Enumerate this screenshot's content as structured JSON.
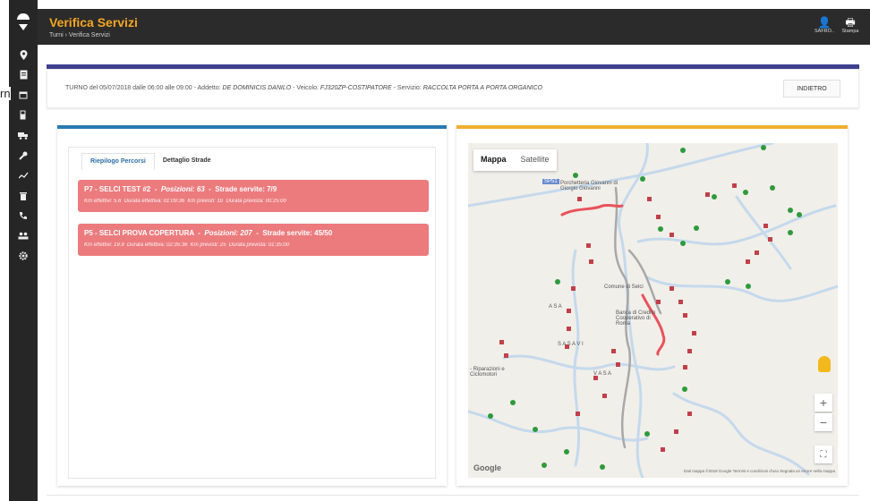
{
  "stray_text": "rn",
  "header": {
    "title": "Verifica Servizi",
    "breadcrumb": "Turni › Verifica Servizi",
    "actions": [
      {
        "label": "SAFRO..",
        "icon": "user-icon"
      },
      {
        "label": "Stampa",
        "icon": "print-icon"
      }
    ]
  },
  "sidebar": {
    "icons": [
      "map-pin-icon",
      "document-icon",
      "calendar-icon",
      "fuel-icon",
      "truck-icon",
      "wrench-icon",
      "chart-icon",
      "trash-icon",
      "phone-icon",
      "users-icon",
      "gear-icon"
    ]
  },
  "shift": {
    "date_label": "TURNO del 05/07/2018 dalle 06:00 alle 09:00",
    "addetto_label": "Addetto:",
    "addetto": "DE DOMINICIS DANILO",
    "veicolo_label": "Veicolo:",
    "veicolo": "FJ320ZP-COSTIPATORE",
    "servizio_label": "Servizio:",
    "servizio": "RACCOLTA PORTA A PORTA ORGANICO",
    "sep": "-",
    "back_label": "INDIETRO"
  },
  "tabs": [
    {
      "label": "Riepilogo Percorsi",
      "active": true
    },
    {
      "label": "Dettaglio Strade",
      "active": false
    }
  ],
  "routes": [
    {
      "name": "P7 - SELCI TEST #2",
      "pos_label": "Posizioni: 63",
      "strade": "Strade servite: 7/9",
      "km_eff": "Km effettivi: 5.6",
      "dur_eff": "Durata effettiva: 01:09:36",
      "km_prev": "Km previsti: 10",
      "dur_prev": "Durata prevista: 00:25:00"
    },
    {
      "name": "P5 - SELCI PROVA COPERTURA",
      "pos_label": "Posizioni: 207",
      "strade": "Strade servite: 45/50",
      "km_eff": "Km effettivi: 19.9",
      "dur_eff": "Durata effettiva: 02:35:36",
      "km_prev": "Km previsti: 25",
      "dur_prev": "Durata prevista: 01:35:00"
    }
  ],
  "map": {
    "types": [
      "Mappa",
      "Satellite"
    ],
    "labels": [
      "Porchetteria Giovanni di Giorgio Giovanni",
      "Comune di Selci",
      "Banca di Credito Cooperativo di Roma",
      "A S A",
      "S A S A V I",
      "V A S A",
      "- Riparazioni e Ciclomotori",
      "SP51"
    ],
    "google": "Google",
    "footer": "Dati mappa ©2018 Google   Termini e condizioni d'uso   Segnala un errore nella mappa",
    "colors": {
      "route": "#e8535b",
      "road": "#c5d9ec",
      "marker_green": "#2e9a3c",
      "marker_flag": "#c0404a"
    }
  },
  "colors": {
    "accent": "#f5a623",
    "left_bar": "#2a7ab0",
    "right_bar": "#f0ad30",
    "route_card": "#ec7b7e",
    "stripe": "#3f3f8f"
  }
}
